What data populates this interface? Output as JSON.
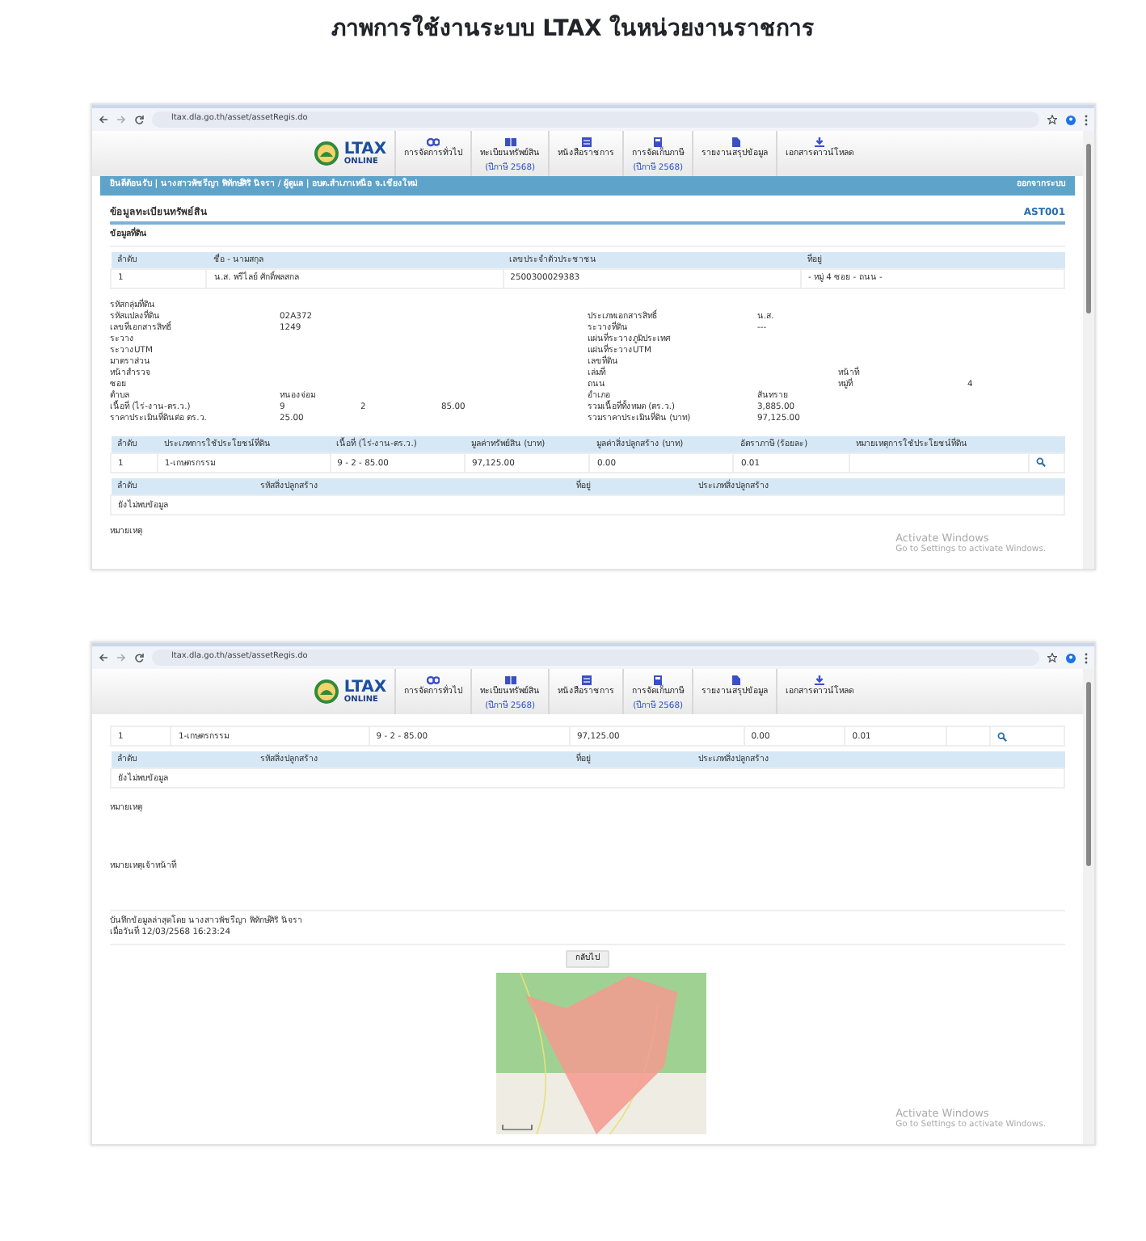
{
  "title": "ภาพการใช้งานระบบ LTAX ในหน่วยงานราชการ",
  "windows": [
    {
      "url": "ltax.dla.go.th/asset/assetRegis.do",
      "logo": {
        "name": "LTAX",
        "sub": "ONLINE"
      },
      "menu": [
        {
          "label": "การจัดการทั่วไป"
        },
        {
          "label": "ทะเบียนทรัพย์สิน",
          "note": "(ปีภาษี 2568)"
        },
        {
          "label": "หนังสือราชการ"
        },
        {
          "label": "การจัดเก็บภาษี",
          "note": "(ปีภาษี 2568)"
        },
        {
          "label": "รายงานสรุปข้อมูล"
        },
        {
          "label": "เอกสารดาวน์โหลด"
        }
      ],
      "breadcrumb": {
        "text": "ยินดีต้อนรับ | นางสาวพัชรีญา พิทักษ์ศิริ นิจรา / ผู้ดูแล | อบต.สำเภาเหนือ จ.เชียงใหม่",
        "logout": "ออกจากระบบ"
      },
      "blocks": [
        {
          "kind": "section",
          "title": "ข้อมูลทะเบียนทรัพย์สิน",
          "code": "AST001"
        },
        {
          "kind": "subheader",
          "text": "ข้อมูลที่ดิน"
        },
        {
          "kind": "table",
          "columns": [
            "ลำดับ",
            "ชื่อ - นามสกุล",
            "เลขประจำตัวประชาชน",
            "ที่อยู่"
          ],
          "rows": [
            [
              "1",
              "น.ส. พรีไลย์ ศักดิ์พลสกล",
              "2500300029383",
              "- หมู่ 4 ซอย - ถนน -"
            ]
          ]
        },
        {
          "kind": "details",
          "rows": [
            {
              "left": [
                {
                  "label": "รหัสกลุ่มที่ดิน"
                }
              ],
              "right": []
            },
            {
              "left": [
                {
                  "label": "รหัสแปลงที่ดิน",
                  "values": [
                    "02A372"
                  ]
                }
              ],
              "right": [
                {
                  "label": "ประเภทเอกสารสิทธิ์",
                  "values": [
                    "น.ส."
                  ]
                }
              ]
            },
            {
              "left": [
                {
                  "label": "เลขที่เอกสารสิทธิ์",
                  "values": [
                    "1249"
                  ]
                }
              ],
              "right": [
                {
                  "label": "ระวางที่ดิน",
                  "values": [
                    "---"
                  ]
                }
              ]
            },
            {
              "left": [
                {
                  "label": "ระวาง"
                }
              ],
              "right": [
                {
                  "label": "แผ่นที่ระวางภูมิประเทศ"
                }
              ]
            },
            {
              "left": [
                {
                  "label": "ระวางUTM"
                }
              ],
              "right": [
                {
                  "label": "แผ่นที่ระวางUTM"
                }
              ]
            },
            {
              "left": [
                {
                  "label": "มาตราส่วน"
                }
              ],
              "right": [
                {
                  "label": "เลขที่ดิน"
                }
              ]
            },
            {
              "left": [
                {
                  "label": "หน้าสำรวจ"
                }
              ],
              "right": [
                {
                  "label": "เล่มที่"
                },
                {
                  "label": "หน้าที่"
                }
              ]
            },
            {
              "left": [
                {
                  "label": "ซอย"
                }
              ],
              "right": [
                {
                  "label": "ถนน"
                },
                {
                  "label": "หมู่ที่",
                  "values": [
                    "4"
                  ]
                }
              ]
            },
            {
              "left": [
                {
                  "label": "ตำบล",
                  "values": [
                    "หนองจ่อม"
                  ]
                }
              ],
              "right": [
                {
                  "label": "อำเภอ",
                  "values": [
                    "สันทราย"
                  ]
                }
              ]
            },
            {
              "left": [
                {
                  "label": "เนื้อที่ (ไร่-งาน-ตร.ว.)",
                  "values": [
                    "9",
                    "2",
                    "85.00"
                  ]
                }
              ],
              "right": [
                {
                  "label": "รวมเนื้อที่ทั้งหมด (ตร.ว.)",
                  "values": [
                    "3,885.00"
                  ]
                }
              ]
            },
            {
              "left": [
                {
                  "label": "ราคาประเมินที่ดินต่อ ตร.ว.",
                  "values": [
                    "25.00"
                  ]
                }
              ],
              "right": [
                {
                  "label": "รวมราคาประเมินที่ดิน (บาท)",
                  "values": [
                    "97,125.00"
                  ]
                }
              ]
            }
          ]
        },
        {
          "kind": "view_table",
          "columns": [
            "ลำดับ",
            "ประเภทการใช้ประโยชน์ที่ดิน",
            "เนื้อที่ (ไร่-งาน-ตร.ว.)",
            "มูลค่าทรัพย์สิน (บาท)",
            "มูลค่าสิ่งปลูกสร้าง (บาท)",
            "อัตราภาษี (ร้อยละ)",
            "หมายเหตุการใช้ประโยชน์ที่ดิน"
          ],
          "rows": [
            [
              "1",
              "1-เกษตรกรรม",
              "9 - 2 - 85.00",
              "97,125.00",
              "0.00",
              "0.01"
            ]
          ]
        },
        {
          "kind": "table",
          "columns": [
            "ลำดับ",
            "รหัสสิ่งปลูกสร้าง",
            "ที่อยู่",
            "ประเภทสิ่งปลูกสร้าง"
          ],
          "empty_text": "ยังไม่พบข้อมูล"
        },
        {
          "kind": "note",
          "label": "หมายเหตุ"
        }
      ],
      "os_notice": {
        "title": "Activate Windows",
        "text": "Go to Settings to activate Windows."
      }
    },
    {
      "url": "ltax.dla.go.th/asset/assetRegis.do",
      "logo": {
        "name": "LTAX",
        "sub": "ONLINE"
      },
      "menu": [
        {
          "label": "การจัดการทั่วไป"
        },
        {
          "label": "ทะเบียนทรัพย์สิน",
          "note": "(ปีภาษี 2568)"
        },
        {
          "label": "หนังสือราชการ"
        },
        {
          "label": "การจัดเก็บภาษี",
          "note": "(ปีภาษี 2568)"
        },
        {
          "label": "รายงานสรุปข้อมูล"
        },
        {
          "label": "เอกสารดาวน์โหลด"
        }
      ],
      "blocks": [
        {
          "kind": "view_table",
          "rows": [
            [
              "1",
              "1-เกษตรกรรม",
              "9 - 2 - 85.00",
              "97,125.00",
              "0.00",
              "0.01"
            ]
          ]
        },
        {
          "kind": "table",
          "columns": [
            "ลำดับ",
            "รหัสสิ่งปลูกสร้าง",
            "ที่อยู่",
            "ประเภทสิ่งปลูกสร้าง"
          ],
          "empty_text": "ยังไม่พบข้อมูล"
        },
        {
          "kind": "note",
          "label": "หมายเหตุ"
        },
        {
          "kind": "note",
          "label": "หมายเหตุเจ้าหน้าที่"
        },
        {
          "kind": "saved",
          "lines": [
            "บันทึกข้อมูลล่าสุดโดย นางสาวพัชรีญา พิทักษ์ศิริ นิจรา",
            "เมื่อวันที่ 12/03/2568 16:23:24"
          ]
        },
        {
          "kind": "button",
          "label": "กลับไป"
        },
        {
          "kind": "map"
        }
      ],
      "os_notice": {
        "title": "Activate Windows",
        "text": "Go to Settings to activate Windows."
      }
    }
  ]
}
